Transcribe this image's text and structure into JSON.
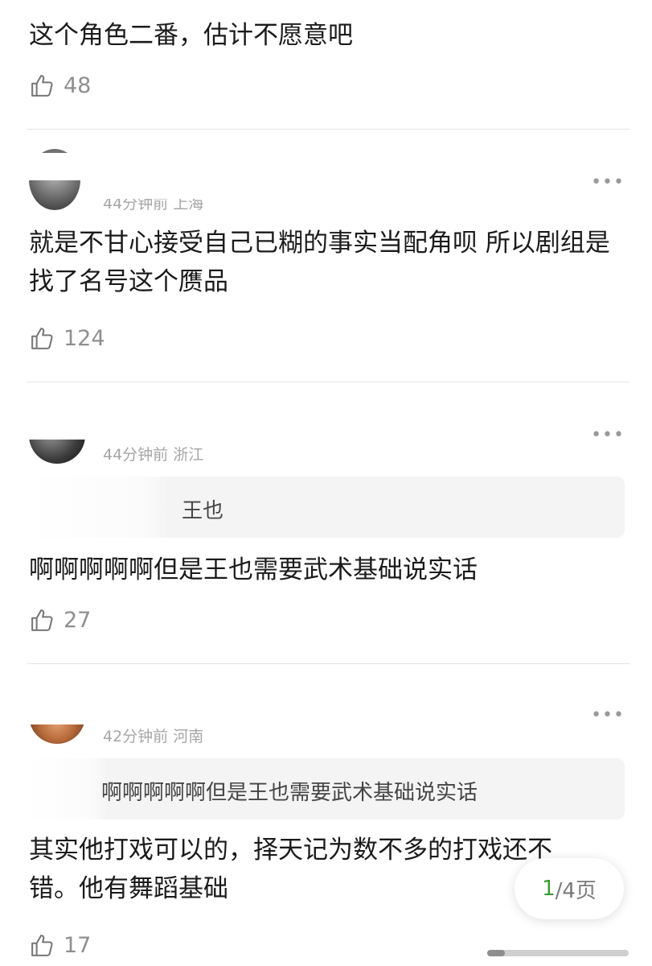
{
  "comments": [
    {
      "meta": "",
      "text": "这个角色二番，估计不愿意吧",
      "likes": "48"
    },
    {
      "meta": "44分钟前 上海",
      "text": "就是不甘心接受自己已糊的事实当配角呗 所以剧组是找了名号这个赝品",
      "likes": "124"
    },
    {
      "meta": "44分钟前 浙江",
      "quote": "王也",
      "text": "啊啊啊啊啊但是王也需要武术基础说实话",
      "likes": "27"
    },
    {
      "meta": "42分钟前 河南",
      "quote": "啊啊啊啊啊但是王也需要武术基础说实话",
      "text": "其实他打戏可以的，择天记为数不多的打戏还不错。他有舞蹈基础",
      "likes": "17"
    }
  ],
  "more_label": "•••",
  "pager": {
    "current": "1",
    "rest": "/4页"
  },
  "icons": {
    "like": "thumbs-up-icon",
    "more": "more-dots-icon"
  },
  "colors": {
    "pager_current": "#3c9a34",
    "meta": "#a6a6a6"
  }
}
